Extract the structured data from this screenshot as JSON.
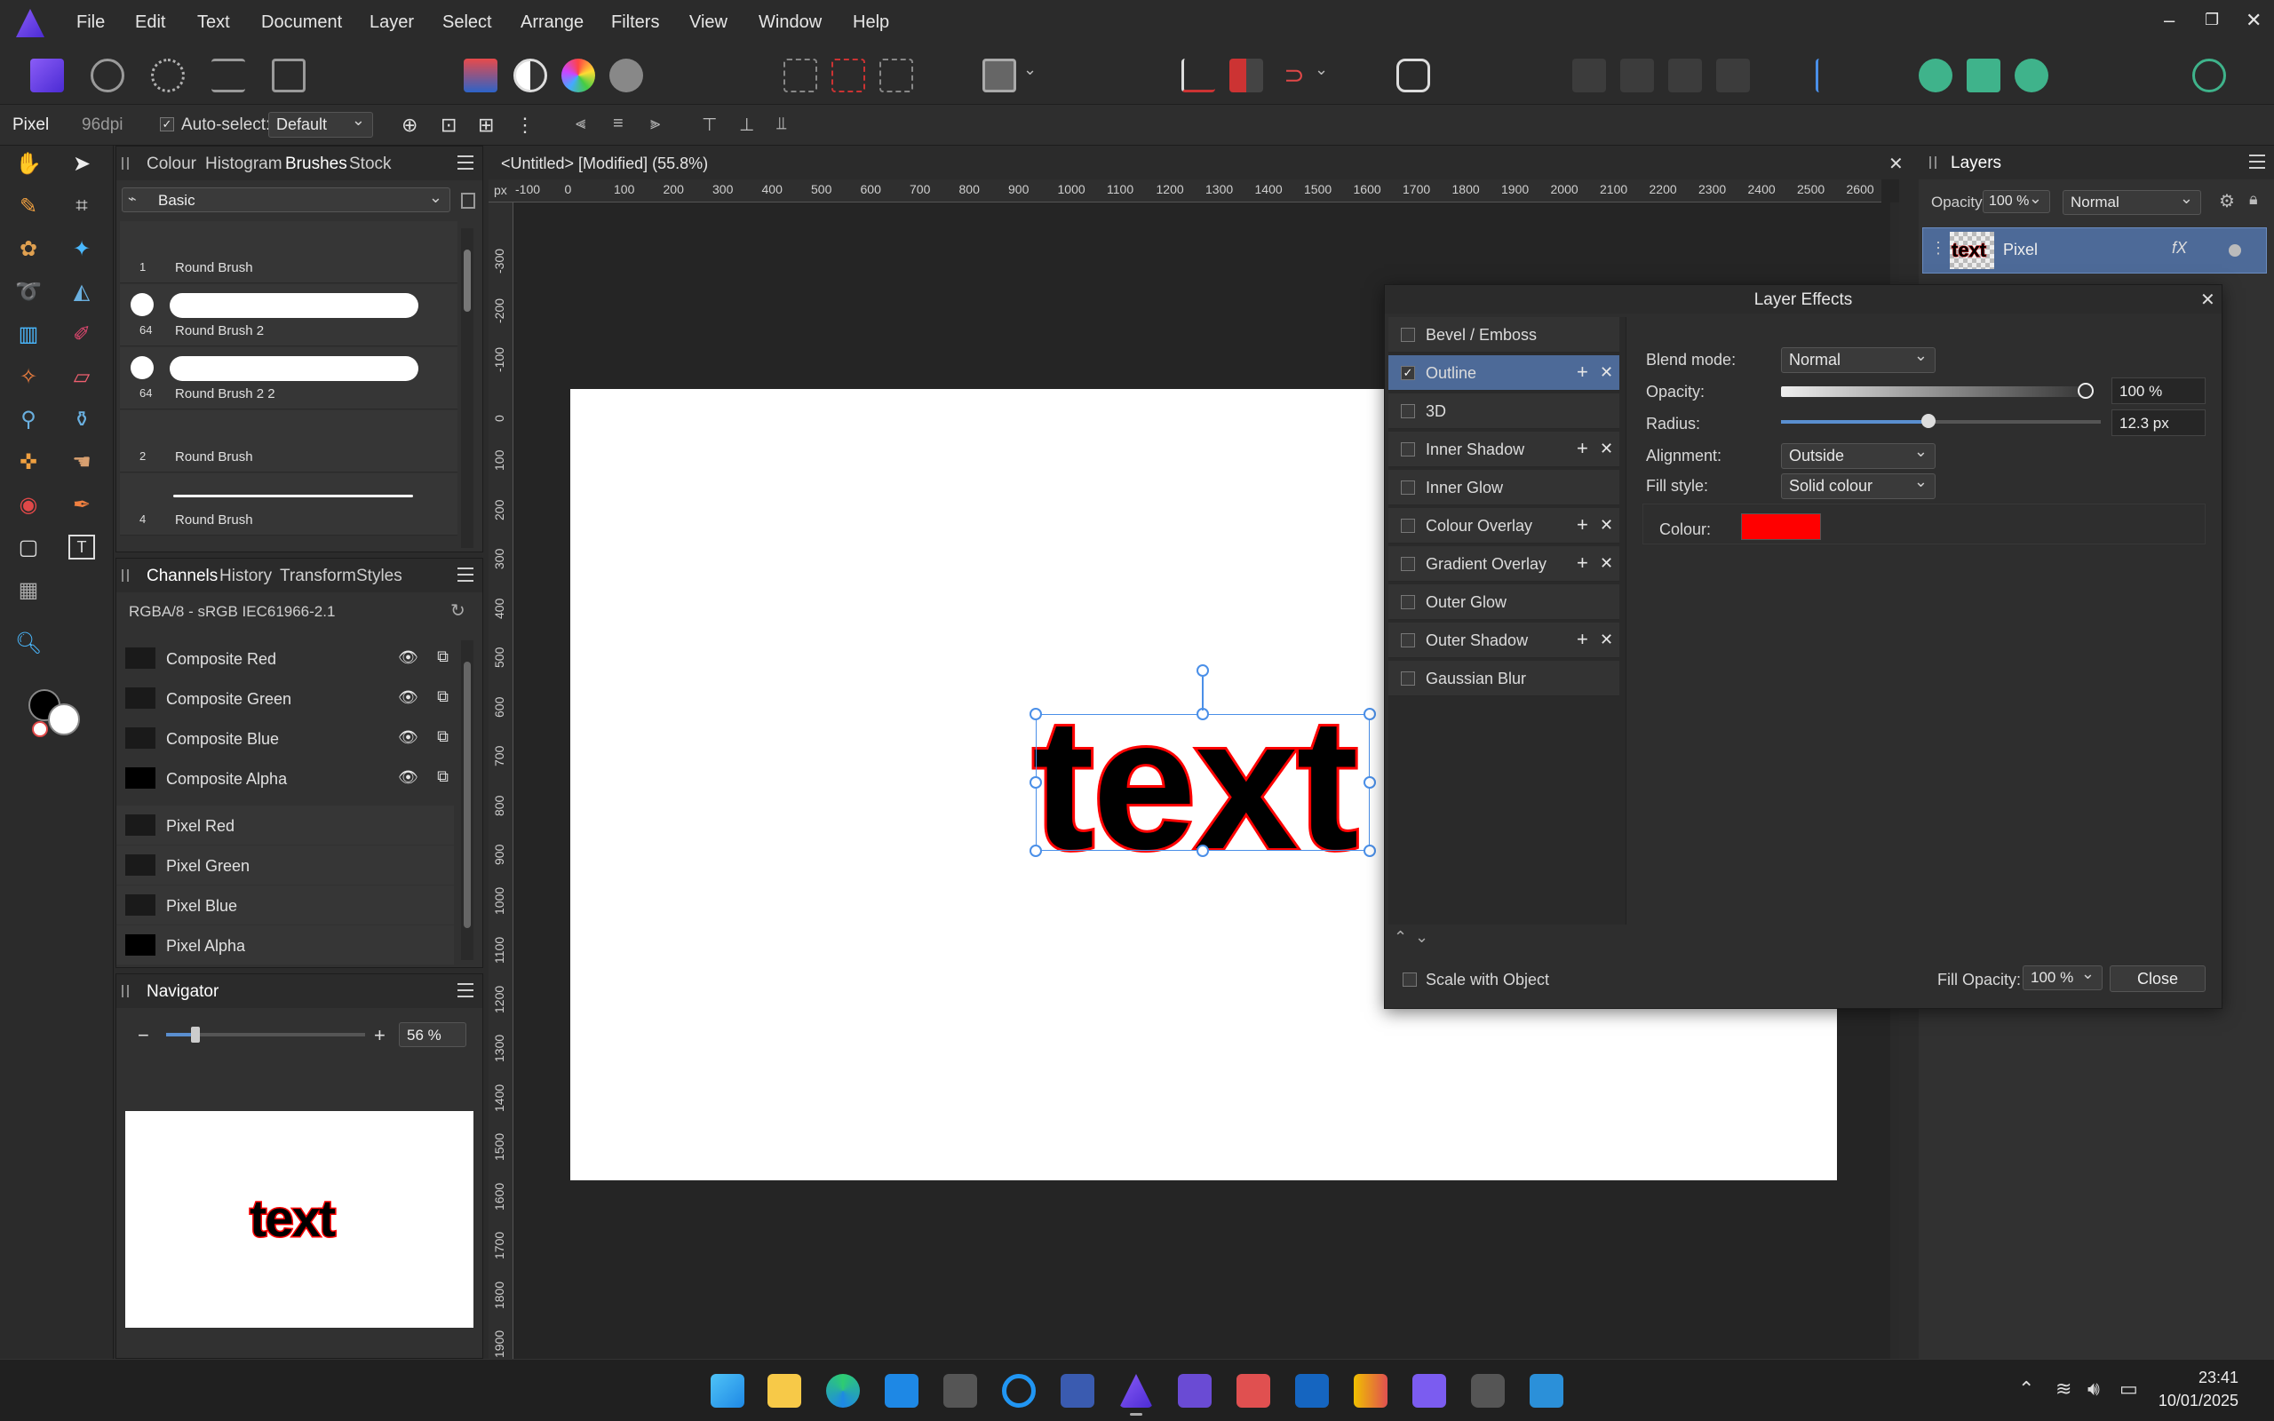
{
  "menu": {
    "items": [
      "File",
      "Edit",
      "Text",
      "Document",
      "Layer",
      "Select",
      "Arrange",
      "Filters",
      "View",
      "Window",
      "Help"
    ]
  },
  "context": {
    "mode": "Pixel",
    "dpi": "96dpi",
    "autoselect_label": "Auto-select:",
    "autoselect_value": "Default"
  },
  "brushes_panel": {
    "tabs": [
      "Colour",
      "Histogram",
      "Brushes",
      "Stock"
    ],
    "active_tab": "Brushes",
    "category": "Basic",
    "items": [
      {
        "size": "1",
        "name": "Round Brush"
      },
      {
        "size": "64",
        "name": "Round Brush 2"
      },
      {
        "size": "64",
        "name": "Round Brush 2 2"
      },
      {
        "size": "2",
        "name": "Round Brush"
      },
      {
        "size": "4",
        "name": "Round Brush"
      }
    ]
  },
  "channels_panel": {
    "tabs": [
      "Channels",
      "History",
      "Transform",
      "Styles"
    ],
    "active_tab": "Channels",
    "profile": "RGBA/8 - sRGB IEC61966-2.1",
    "composite": [
      "Composite Red",
      "Composite Green",
      "Composite Blue",
      "Composite Alpha"
    ],
    "pixel": [
      "Pixel Red",
      "Pixel Green",
      "Pixel Blue",
      "Pixel Alpha"
    ]
  },
  "navigator": {
    "title": "Navigator",
    "zoom": "56 %",
    "zoom_fraction": 0.56,
    "preview_text": "text"
  },
  "document": {
    "title": "<Untitled> [Modified] (55.8%)",
    "unit": "px",
    "ruler_h": [
      "-100",
      "0",
      "100",
      "200",
      "300",
      "400",
      "500",
      "600",
      "700",
      "800",
      "900",
      "1000",
      "1100",
      "1200",
      "1300",
      "1400",
      "1500",
      "1600",
      "1700",
      "1800",
      "1900",
      "2000",
      "2100",
      "2200",
      "2300",
      "2400",
      "2500",
      "2600"
    ],
    "ruler_v": [
      "-300",
      "-200",
      "-100",
      "0",
      "100",
      "200",
      "300",
      "400",
      "500",
      "600",
      "700",
      "800",
      "900",
      "1000",
      "1100",
      "1200",
      "1300",
      "1400",
      "1500",
      "1600",
      "1700",
      "1800",
      "1900"
    ],
    "canvas_text": "text"
  },
  "layers_panel": {
    "title": "Layers",
    "opacity_label": "Opacity:",
    "opacity_value": "100 %",
    "blend_mode": "Normal",
    "layer_name": "Pixel",
    "layer_thumb_text": "text",
    "fx_badge": "fX"
  },
  "layer_effects": {
    "title": "Layer Effects",
    "effects": [
      {
        "label": "Bevel / Emboss",
        "checked": false,
        "extra": false,
        "active": false
      },
      {
        "label": "Outline",
        "checked": true,
        "extra": true,
        "active": true
      },
      {
        "label": "3D",
        "checked": false,
        "extra": false,
        "active": false
      },
      {
        "label": "Inner Shadow",
        "checked": false,
        "extra": true,
        "active": false
      },
      {
        "label": "Inner Glow",
        "checked": false,
        "extra": false,
        "active": false
      },
      {
        "label": "Colour Overlay",
        "checked": false,
        "extra": true,
        "active": false
      },
      {
        "label": "Gradient Overlay",
        "checked": false,
        "extra": true,
        "active": false
      },
      {
        "label": "Outer Glow",
        "checked": false,
        "extra": false,
        "active": false
      },
      {
        "label": "Outer Shadow",
        "checked": false,
        "extra": true,
        "active": false
      },
      {
        "label": "Gaussian Blur",
        "checked": false,
        "extra": false,
        "active": false
      }
    ],
    "props": {
      "blend_mode_label": "Blend mode:",
      "blend_mode_value": "Normal",
      "opacity_label": "Opacity:",
      "opacity_value": "100 %",
      "opacity_fraction": 1.0,
      "radius_label": "Radius:",
      "radius_value": "12.3 px",
      "radius_fraction": 0.46,
      "alignment_label": "Alignment:",
      "alignment_value": "Outside",
      "fill_style_label": "Fill style:",
      "fill_style_value": "Solid colour",
      "colour_label": "Colour:",
      "colour_value": "#ff0000"
    },
    "scale_with_object": "Scale with Object",
    "fill_opacity_label": "Fill Opacity:",
    "fill_opacity_value": "100 %",
    "close_label": "Close"
  },
  "taskbar": {
    "time": "23:41",
    "date": "10/01/2025"
  },
  "colors": {
    "accent": "#4d6a98",
    "outline": "#ff0000",
    "selection": "#4a8fe8"
  }
}
